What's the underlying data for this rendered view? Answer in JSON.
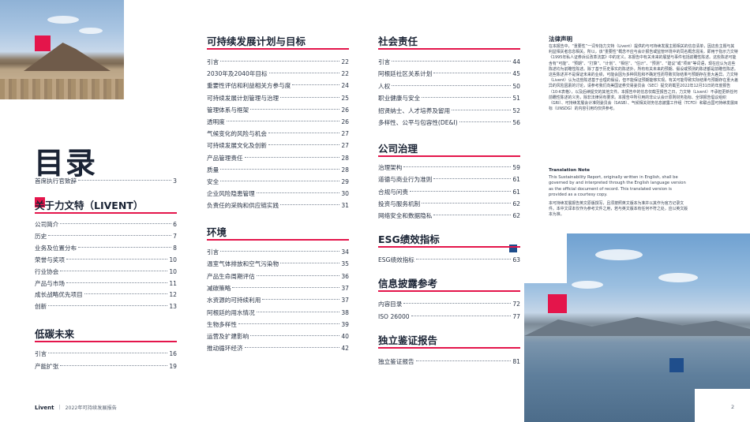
{
  "title": "目录",
  "left_top_entries": [
    {
      "label": "首席执行官致辞",
      "page": "3"
    }
  ],
  "sections": [
    {
      "heading": "关于力文特（LIVENT）",
      "entries": [
        {
          "label": "公司简介",
          "page": "6"
        },
        {
          "label": "历史",
          "page": "7"
        },
        {
          "label": "业务及位置分布",
          "page": "8"
        },
        {
          "label": "荣誉与奖项",
          "page": "10"
        },
        {
          "label": "行业协会",
          "page": "10"
        },
        {
          "label": "产品与市场",
          "page": "11"
        },
        {
          "label": "成长战略优先项目",
          "page": "12"
        },
        {
          "label": "创新",
          "page": "13"
        }
      ]
    },
    {
      "heading": "低碳未来",
      "entries": [
        {
          "label": "引言",
          "page": "16"
        },
        {
          "label": "产能扩张",
          "page": "19"
        }
      ]
    },
    {
      "heading": "可持续发展计划与目标",
      "entries": [
        {
          "label": "引言",
          "page": "22"
        },
        {
          "label": "2030年及2040年目标",
          "page": "22"
        },
        {
          "label": "重要性评估和利益相关方参与度",
          "page": "24"
        },
        {
          "label": "可持续发展计划管理与治理",
          "page": "25"
        },
        {
          "label": "管理体系与框架",
          "page": "26"
        },
        {
          "label": "透明度",
          "page": "26"
        },
        {
          "label": "气候变化的风险与机会",
          "page": "27"
        },
        {
          "label": "可持续发展文化及创新",
          "page": "27"
        },
        {
          "label": "产品管理责任",
          "page": "28"
        },
        {
          "label": "质量",
          "page": "28"
        },
        {
          "label": "安全",
          "page": "29"
        },
        {
          "label": "企业风险隐患管理",
          "page": "30"
        },
        {
          "label": "负责任的采购和供应链实践",
          "page": "31"
        }
      ]
    },
    {
      "heading": "环境",
      "entries": [
        {
          "label": "引言",
          "page": "34"
        },
        {
          "label": "温室气体排放和空气污染物",
          "page": "35"
        },
        {
          "label": "产品生命周期评估",
          "page": "36"
        },
        {
          "label": "减碳策略",
          "page": "37"
        },
        {
          "label": "水资源的可持续利用",
          "page": "37"
        },
        {
          "label": "阿根廷的用水情况",
          "page": "38"
        },
        {
          "label": "生物多样性",
          "page": "39"
        },
        {
          "label": "运营及扩建影响",
          "page": "40"
        },
        {
          "label": "推动循环经济",
          "page": "42"
        }
      ]
    },
    {
      "heading": "社会责任",
      "entries": [
        {
          "label": "引言",
          "page": "44"
        },
        {
          "label": "阿根廷社区关系计划",
          "page": "45"
        },
        {
          "label": "人权",
          "page": "50"
        },
        {
          "label": "职业健康与安全",
          "page": "51"
        },
        {
          "label": "招贤纳士、人才培养及留用",
          "page": "52"
        },
        {
          "label": "多样性、公平与包容性(DE&I)",
          "page": "56"
        }
      ]
    },
    {
      "heading": "公司治理",
      "entries": [
        {
          "label": "治理架构",
          "page": "59"
        },
        {
          "label": "道德与商业行为准则",
          "page": "61"
        },
        {
          "label": "合规与问责",
          "page": "61"
        },
        {
          "label": "投资与服务机制",
          "page": "62"
        },
        {
          "label": "网络安全和数据隐私",
          "page": "62"
        }
      ]
    },
    {
      "heading": "ESG绩效指标",
      "entries": [
        {
          "label": "ESG绩效指标",
          "page": "63"
        }
      ]
    },
    {
      "heading": "信息披露参考",
      "entries": [
        {
          "label": "内容目录",
          "page": "72"
        },
        {
          "label": "ISO 26000",
          "page": "77"
        }
      ]
    },
    {
      "heading": "独立鉴证报告",
      "entries": [
        {
          "label": "独立鉴证报告",
          "page": "81"
        }
      ]
    }
  ],
  "legal": {
    "title": "法律声明",
    "body": "在本报告中，“重要性”一词专指力文特（Livent）提供的与可持续发展主题相关的信息清单，因这些主题与其利益相关者息息相关。所以，该“重要性”概念不应与会计报告或监管环境中的同名概念混淆，即用于指示力文特《1995年私人证券诉讼改革法案》中的定义。本报告中有关未来的展望与事件包括前瞻性陈述。这些陈述可能含有“可能”、“预期”、“打算”、“计划”、“相信”、“估计”、“预测”、“建议”或“项目”等词语，现在应认为这些陈述均为前瞻性陈述。除了基于历史事实的陈述外，所有有关未来的预期、假设或预测的陈述都是前瞻性陈述。这些陈述并不是保证未来的业绩，可能会因为多种风险和不确定性而导致实际结果与预期存在重大差异。力文特（Livent）认为这些陈述基于合理的假设，但不能保证预期能够实现。有关可能导致实际结果与预期存在重大差异的风险因素的讨论，请参考我们向美国证券交易委员会（SEC）提交的截至2022年12月31日的年度报告（10-K表格），以及后续提交的其他文件。本报告中的信息仅截至报告之日，力文特（Livent）不承担更新任何前瞻性陈述的义务，除非法律另有要求。本报告中所引用的非公认会计原则财务指标、全球报告倡议组织（GRI）、可持续发展会计准则委员会（SASB）、气候相关财务信息披露工作组（TCFD）和联合国可持续发展目标（UNSDG）的内容引用均仅供参考。"
  },
  "translation_note": {
    "title": "Translation Note",
    "body": "This Sustainability Report, originally written in English, shall be governed by and interpreted through the English language version as the official document of record. This translated version is provided as a courtesy copy.",
    "body_zh": "本可持续发展报告英文原版撰写，且须按照英文版本为准并以其作为官方记录文件。本中文译本仅作为参考文件之用，若与英文版本有任何不符之处，应以英文版本为准。"
  },
  "footer": {
    "brand": "Livent",
    "separator": "|",
    "report_title": "2022年可持续发展报告",
    "page_number": "2"
  },
  "colors": {
    "accent_red": "#e4154b",
    "navy": "#1f4e8c",
    "text": "#1b2435"
  }
}
